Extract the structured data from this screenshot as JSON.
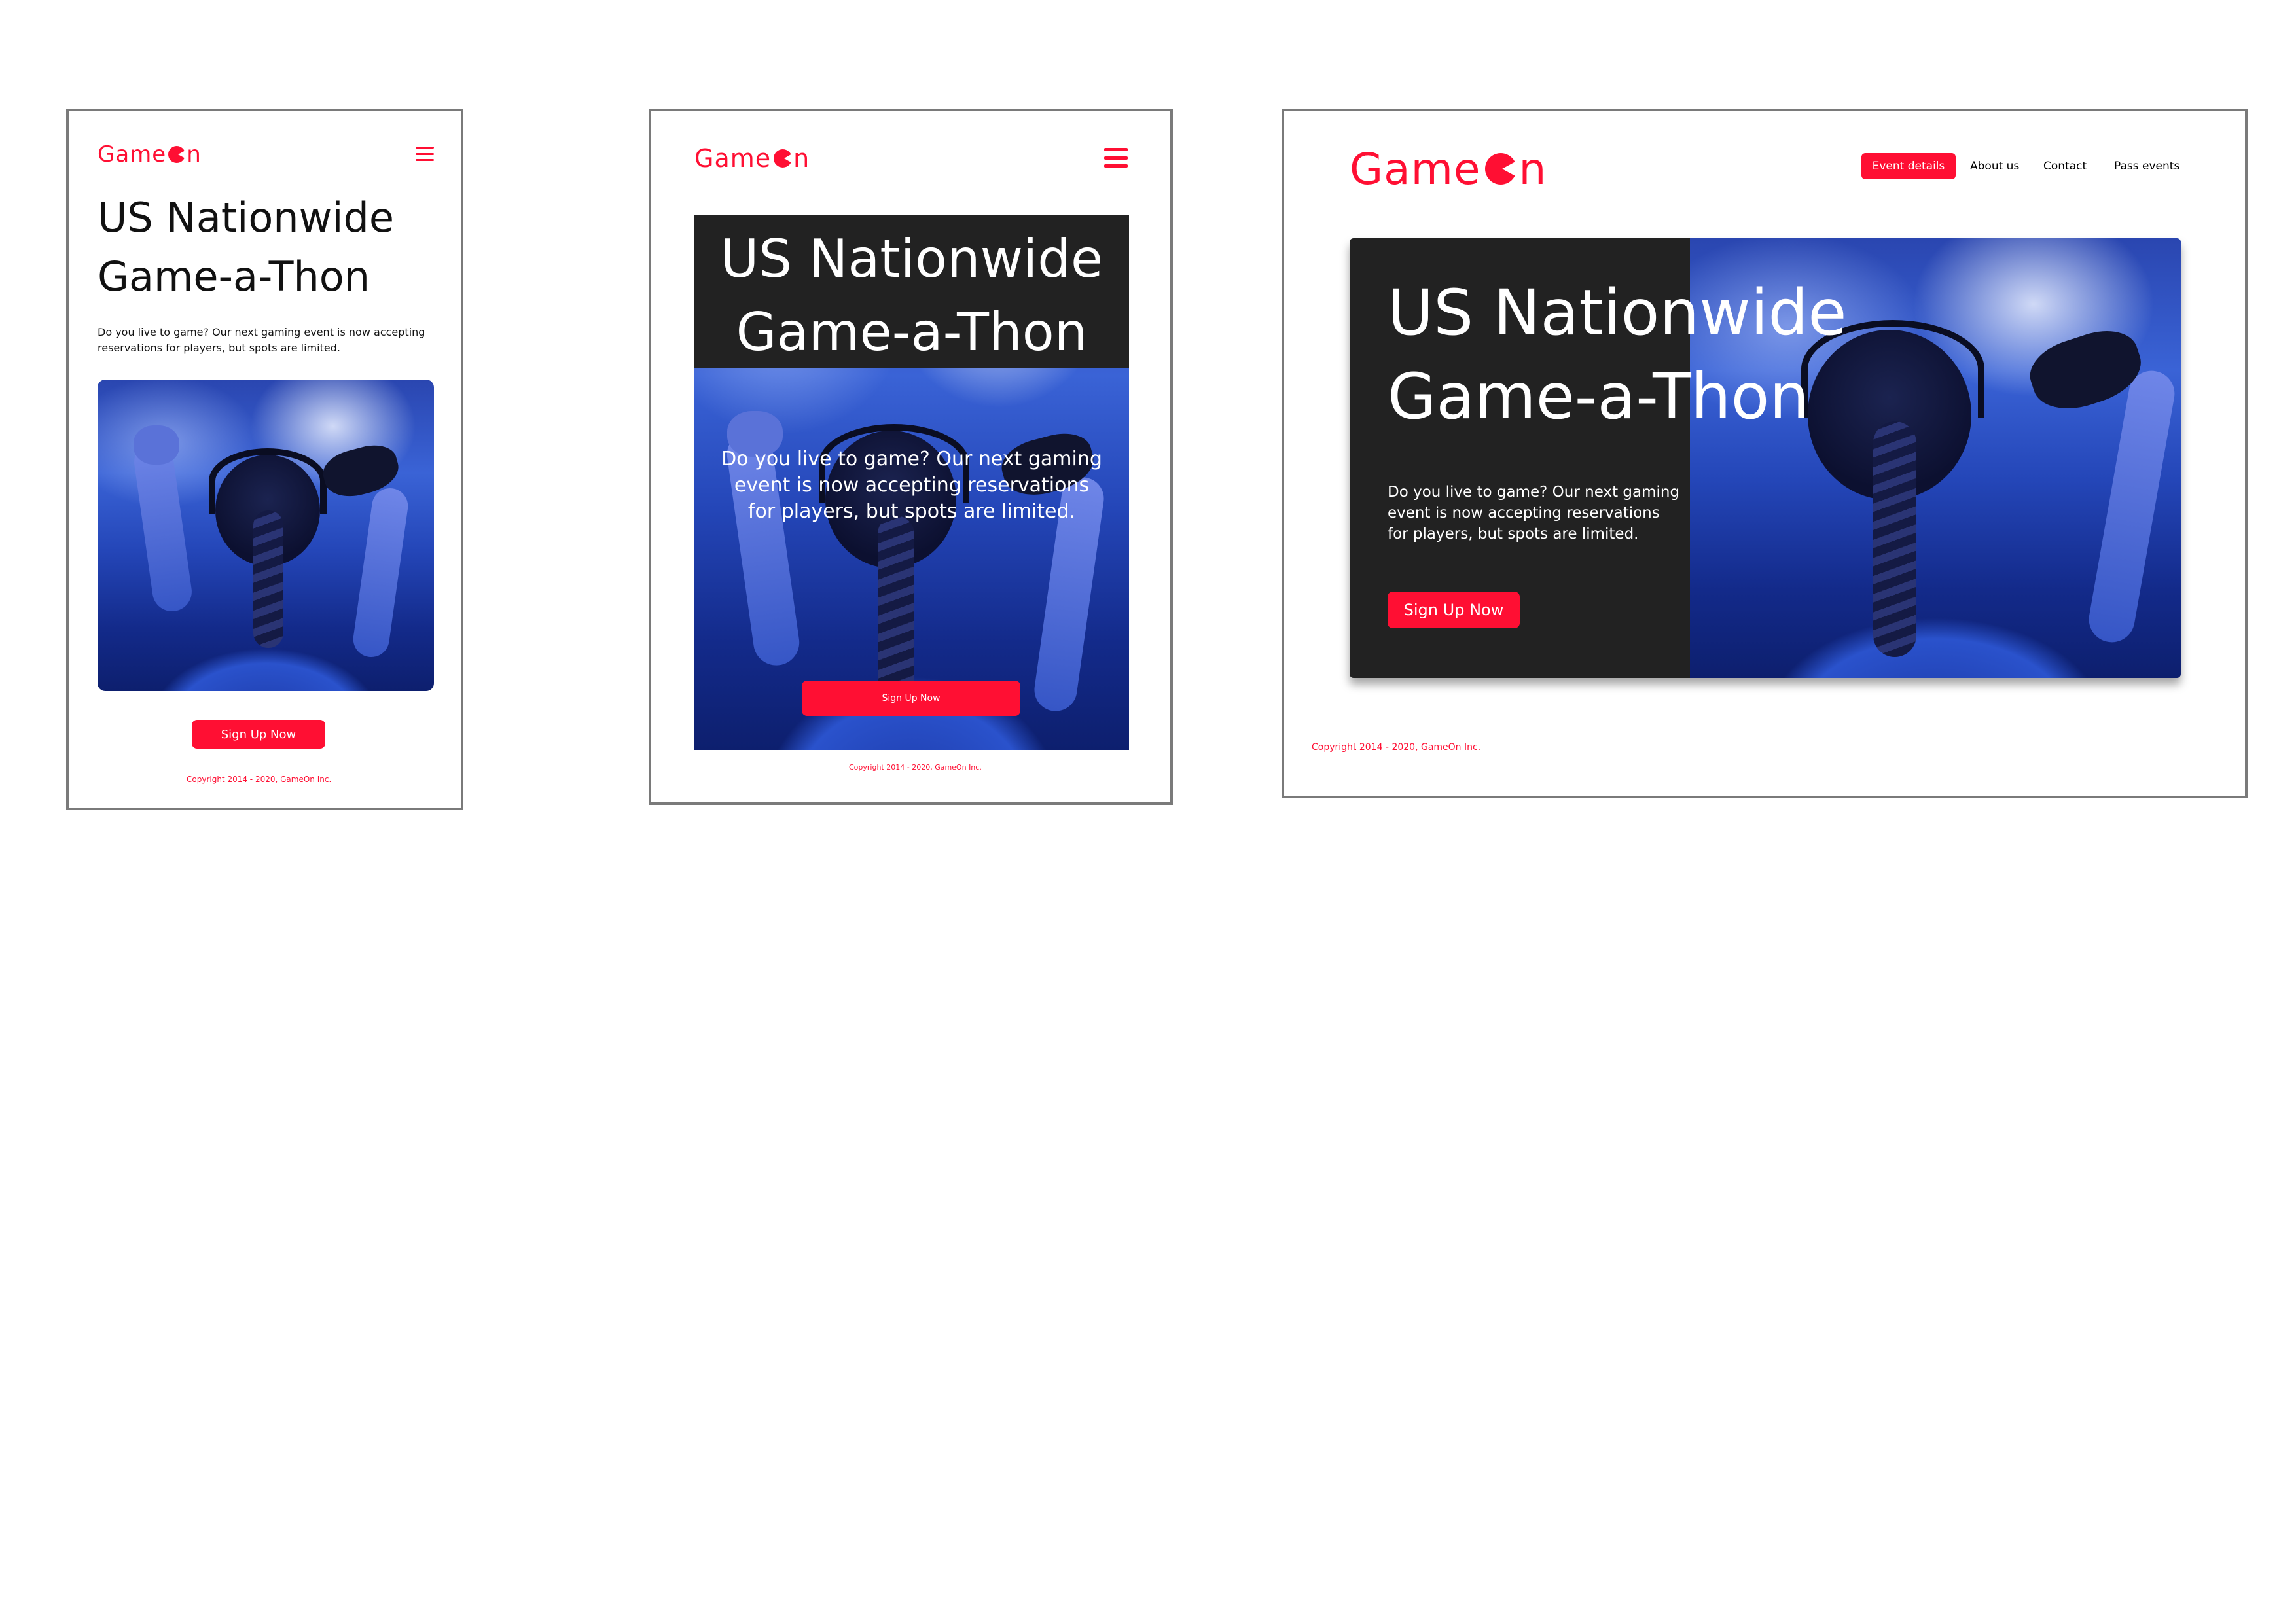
{
  "brand": {
    "logo_prefix": "Game",
    "logo_suffix": "n",
    "accent_color": "#ff0f33",
    "dark_panel_color": "#222222"
  },
  "mobile": {
    "title_line1": "US Nationwide",
    "title_line2": "Game-a-Thon",
    "description": "Do you live to game? Our next gaming event is now accepting reservations for players, but spots are limited.",
    "cta_label": "Sign Up Now",
    "copyright": "Copyright 2014 - 2020, GameOn Inc.",
    "menu_icon": "hamburger-icon"
  },
  "tablet": {
    "title_line1": "US Nationwide",
    "title_line2": "Game-a-Thon",
    "description": "Do you live to game? Our next gaming event is now accepting reservations for players, but spots are limited.",
    "cta_label": "Sign Up Now",
    "copyright": "Copyright 2014 - 2020, GameOn Inc.",
    "menu_icon": "hamburger-icon"
  },
  "desktop": {
    "nav": [
      {
        "label": "Event details",
        "active": true
      },
      {
        "label": "About us",
        "active": false
      },
      {
        "label": "Contact",
        "active": false
      },
      {
        "label": "Pass events",
        "active": false
      }
    ],
    "title_line1": "US Nationwide",
    "title_line2": "Game-a-Thon",
    "description_line1": "Do you live to game? Our next gaming",
    "description_line2": "event is now accepting reservations",
    "description_line3": "for players, but spots are limited.",
    "cta_label": "Sign Up Now",
    "copyright": "Copyright 2014 - 2020, GameOn Inc."
  }
}
